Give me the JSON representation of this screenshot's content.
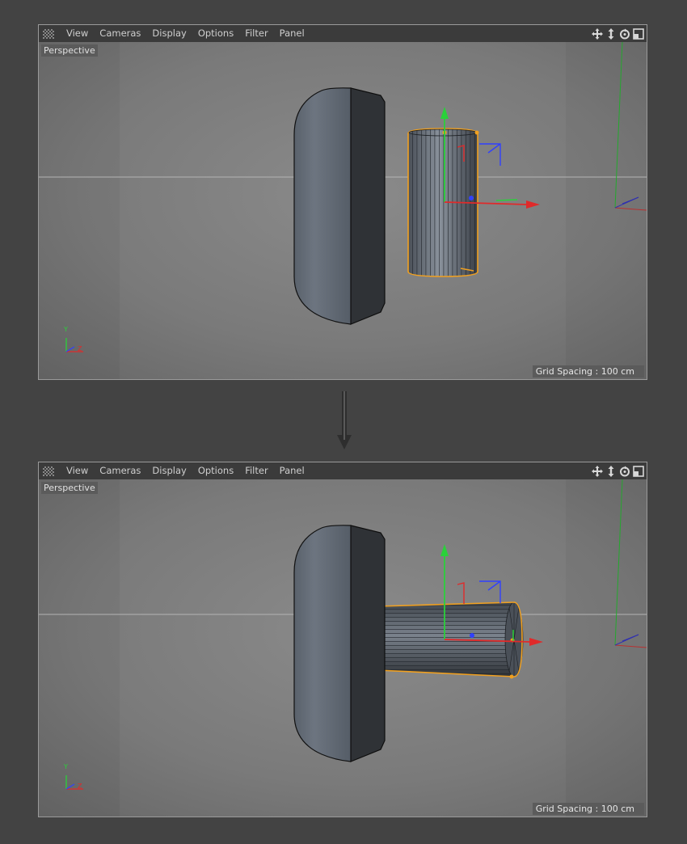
{
  "menu": {
    "items": [
      "View",
      "Cameras",
      "Display",
      "Options",
      "Filter",
      "Panel"
    ]
  },
  "icons": {
    "grip": "grip-icon",
    "move": "move-view-icon",
    "zoom": "zoom-view-icon",
    "rotate": "rotate-view-icon",
    "toggle": "toggle-view-icon",
    "arrow": "arrow-down-icon"
  },
  "viewport": {
    "camera_label": "Perspective",
    "grid_spacing": "Grid Spacing : 100 cm",
    "axis_y": "Y",
    "axis_z": "Z"
  },
  "colors": {
    "selection": "#f0a020",
    "axis_x": "#e02a2a",
    "axis_y": "#2ad13a",
    "axis_z": "#3040ff"
  }
}
